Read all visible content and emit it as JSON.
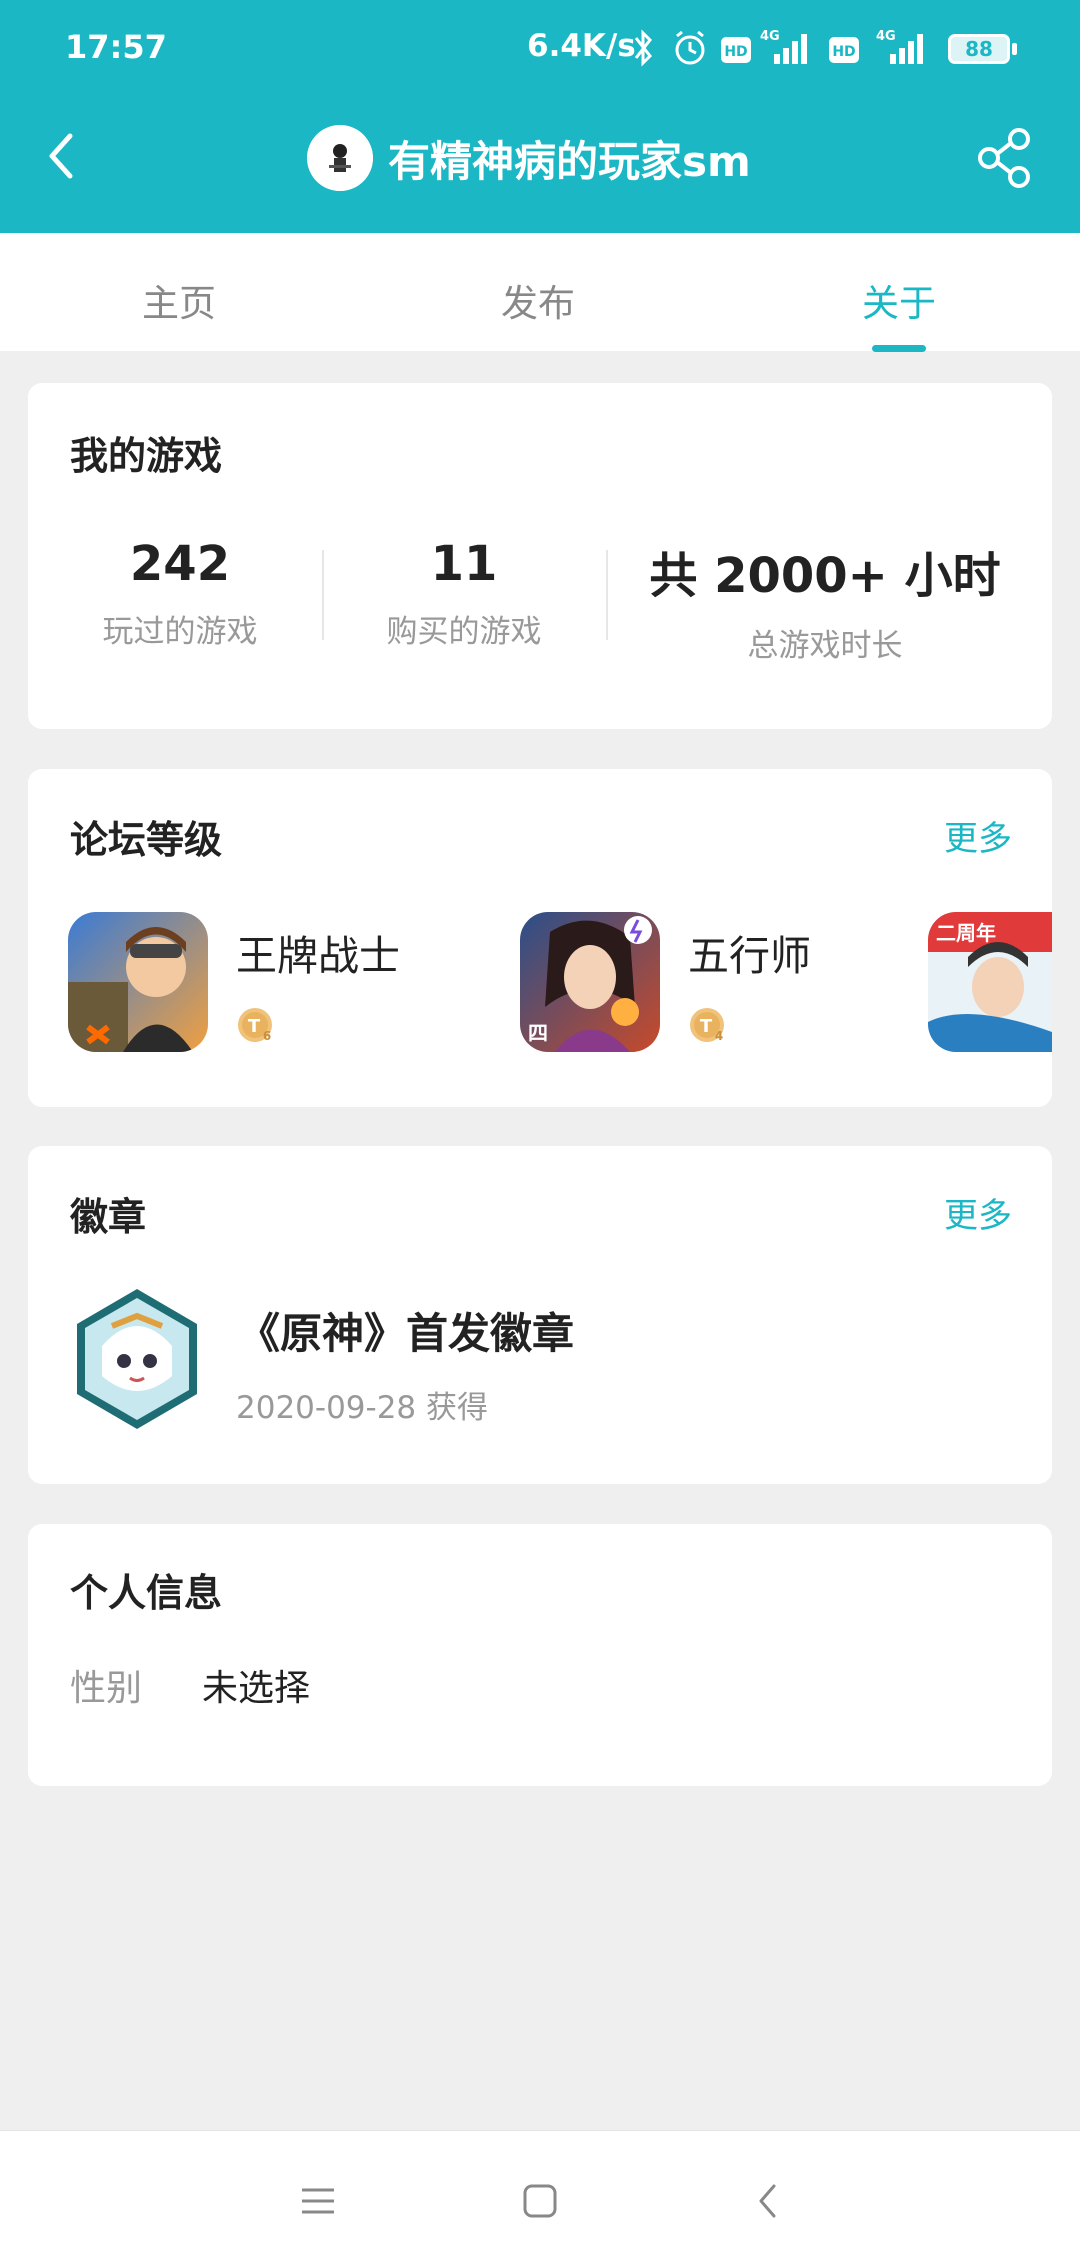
{
  "status_bar": {
    "time": "17:57",
    "network_speed": "6.4K/s",
    "battery": "88",
    "signal_1": "4G",
    "signal_2": "4G",
    "hd_1": "HD",
    "hd_2": "HD"
  },
  "header": {
    "title": "有精神病的玩家sm",
    "bg_color": "#1bb7c4"
  },
  "tabs": [
    {
      "label": "主页",
      "active": false
    },
    {
      "label": "发布",
      "active": false
    },
    {
      "label": "关于",
      "active": true
    }
  ],
  "my_games": {
    "title": "我的游戏",
    "stats": [
      {
        "value": "242",
        "label": "玩过的游戏"
      },
      {
        "value": "11",
        "label": "购买的游戏"
      },
      {
        "value": "共 2000+ 小时",
        "label": "总游戏时长"
      }
    ]
  },
  "forum_level": {
    "title": "论坛等级",
    "more": "更多",
    "games": [
      {
        "name": "王牌战士",
        "level": "6"
      },
      {
        "name": "五行师",
        "level": "4"
      }
    ],
    "third_icon_text": "二周年"
  },
  "badges": {
    "title": "徽章",
    "more": "更多",
    "items": [
      {
        "name": "《原神》首发徽章",
        "date": "2020-09-28 获得"
      }
    ]
  },
  "personal_info": {
    "title": "个人信息",
    "fields": [
      {
        "label": "性别",
        "value": "未选择"
      }
    ]
  }
}
